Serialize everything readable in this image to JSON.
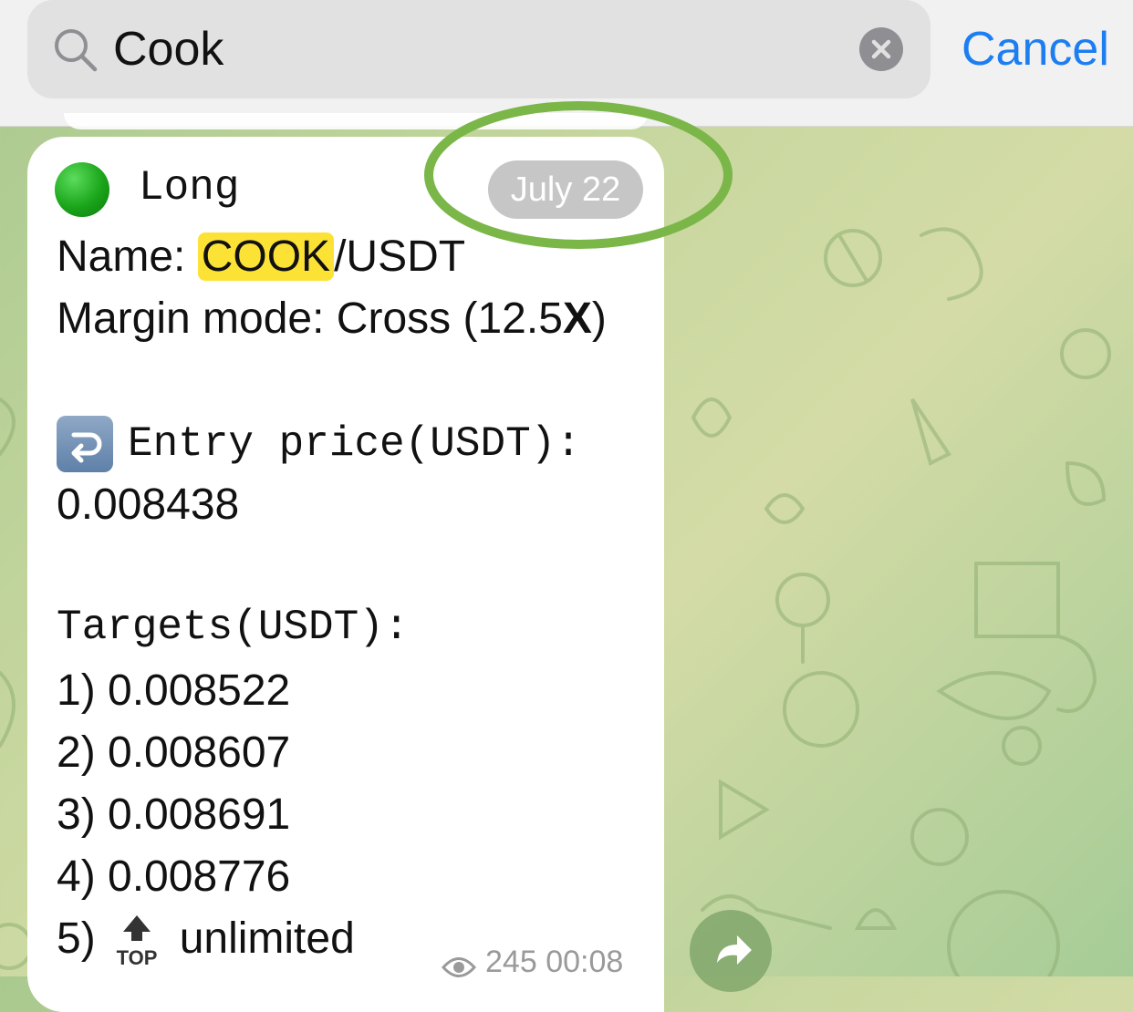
{
  "search": {
    "query": "Cook",
    "cancel_label": "Cancel"
  },
  "message": {
    "direction": "Long",
    "date": "July 22",
    "name_label": "Name: ",
    "name_highlight": "COOK",
    "name_rest": "/USDT",
    "margin_prefix": "Margin mode: Cross (12.5",
    "margin_x": "X",
    "margin_suffix": ")",
    "entry_label": "Entry price(USDT):",
    "entry_value": "0.008438",
    "targets_label": "Targets(USDT):",
    "targets": [
      "1) 0.008522",
      "2) 0.008607",
      "3) 0.008691",
      "4) 0.008776"
    ],
    "target5_prefix": "5)",
    "target5_value": "unlimited",
    "top_icon_label": "TOP",
    "views": "245",
    "time": "00:08"
  },
  "colors": {
    "accent": "#1c7ef0",
    "highlight": "#fde236",
    "ring": "#7ab648",
    "long_dot": "#1aa51a"
  }
}
